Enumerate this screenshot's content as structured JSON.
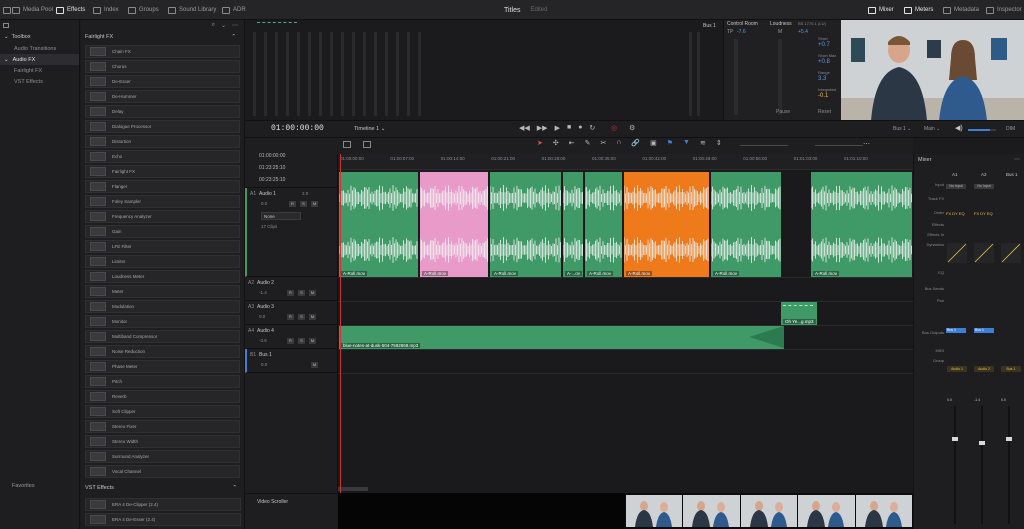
{
  "topbar": {
    "items": [
      {
        "label": "Media Pool",
        "icon": "media-pool-icon",
        "active": false
      },
      {
        "label": "Effects",
        "icon": "effects-icon",
        "active": true
      },
      {
        "label": "Index",
        "icon": "index-icon",
        "active": false
      },
      {
        "label": "Groups",
        "icon": "groups-icon",
        "active": false
      },
      {
        "label": "Sound Library",
        "icon": "sound-library-icon",
        "active": false
      },
      {
        "label": "ADR",
        "icon": "adr-icon",
        "active": false
      }
    ],
    "project_title": "Titles",
    "project_status": "Edited",
    "right_items": [
      {
        "label": "Mixer",
        "icon": "mixer-icon",
        "active": true
      },
      {
        "label": "Meters",
        "icon": "meters-icon",
        "active": true
      },
      {
        "label": "Metadata",
        "icon": "metadata-icon",
        "active": false
      },
      {
        "label": "Inspector",
        "icon": "inspector-icon",
        "active": false
      }
    ]
  },
  "toolbox": {
    "header": "Toolbox",
    "items": [
      {
        "label": "Audio Transitions",
        "selected": false
      },
      {
        "label": "Audio FX",
        "selected": true
      },
      {
        "label": "Fairlight FX",
        "selected": false
      },
      {
        "label": "VST Effects",
        "selected": false
      }
    ],
    "favorites_label": "Favorites"
  },
  "fx_panel": {
    "header": "Fairlight FX",
    "items": [
      "Chain FX",
      "Chorus",
      "De-Esser",
      "De-Hummer",
      "Delay",
      "Dialogue Processor",
      "Distortion",
      "Echo",
      "Fairlight FX",
      "Flanger",
      "Foley Sampler",
      "Frequency Analyzer",
      "Gain",
      "LFE Filter",
      "Limiter",
      "Loudness Meter",
      "Meter",
      "Modulation",
      "Monitor",
      "Multiband Compressor",
      "Noise Reduction",
      "Phase Meter",
      "Pitch",
      "Reverb",
      "Soft Clipper",
      "Stereo Fixer",
      "Stereo Width",
      "Surround Analyzer",
      "Vocal Channel"
    ],
    "vst_header": "VST Effects",
    "vst_items": [
      "ERA 4 De-Clipper (2.4)",
      "ERA 4 De-Esser (2.4)"
    ]
  },
  "meters": {
    "bus_label": "Bus 1",
    "control_room_label": "Control Room",
    "tp_label": "TP",
    "tp_value": "-7.6",
    "m_label": "M",
    "loudness_label": "Loudness",
    "loudness_standard": "BS.1770-1 (LU)",
    "loudness_value": "+5.4",
    "short_label": "Short",
    "short_value": "+0.7",
    "short_max_label": "Short Max",
    "short_max_value": "+0.8",
    "range_label": "Range",
    "range_value": "3.3",
    "integrated_label": "Integrated",
    "integrated_value": "-0.1",
    "pause_label": "Pause",
    "reset_label": "Reset"
  },
  "transport": {
    "timecode": "01:00:00:00",
    "timeline_name": "Timeline 1",
    "bus_select": "Bus 1",
    "main_select": "Main",
    "dim_label": "DIM",
    "monitor_level": 0.8
  },
  "timecodes": [
    "01:00:00:00",
    "01:23:25:10",
    "00:23:25:10"
  ],
  "ruler": [
    "01:00:00:00",
    "01:00:07:00",
    "01:00:14:00",
    "01:00:21:00",
    "01:00:28:00",
    "01:00:35:00",
    "01:00:42:00",
    "01:00:49:00",
    "01:00:56:00",
    "01:01:03:00",
    "01:01:10:00"
  ],
  "tracks": [
    {
      "id": "A1",
      "name": "Audio 1",
      "volume": "0.0",
      "channel": "2.0",
      "plugin": "None",
      "clips_count": "17 Clips"
    },
    {
      "id": "A2",
      "name": "Audio 2",
      "volume": "-1.4",
      "channel": "2.0"
    },
    {
      "id": "A3",
      "name": "Audio 3",
      "volume": "0.0",
      "channel": "2.0"
    },
    {
      "id": "A4",
      "name": "Audio 4",
      "volume": "-3.6",
      "channel": "2.0"
    },
    {
      "id": "B1",
      "name": "Bus 1",
      "volume": "0.0",
      "channel": "2.0"
    }
  ],
  "clips": {
    "a1": [
      "A-Roll.mov",
      "A-Roll.mov",
      "A-Roll.mov",
      "A-...ov",
      "A-Roll.mov",
      "A-Roll.mov",
      "A-Roll.mov",
      "A-Roll.mov"
    ],
    "a3": "Oh Ye...g.mp3",
    "a4": "blue-notes-at-dusk-504-7592868.mp3"
  },
  "colors": {
    "clip_green": "#3f9a67",
    "clip_pink": "#e89ac8",
    "clip_orange": "#ee7a1c",
    "accent_blue": "#3f7fd8",
    "playhead": "#d13030"
  },
  "mixer": {
    "title": "Mixer",
    "columns": [
      "A1",
      "A2",
      "Bus 1"
    ],
    "rows": [
      "Input",
      "Track FX",
      "Order",
      "Effects",
      "Effects In",
      "Dynamics",
      "EQ",
      "Bus Sends",
      "Pan",
      "Bus Outputs",
      "MIDI",
      "Group"
    ],
    "input_values": [
      "No Input",
      "No Input"
    ],
    "order_values": [
      "FX DY EQ",
      "FX DY EQ"
    ],
    "bus_output_values": [
      "Bus 1",
      "Bus 1"
    ],
    "channel_names": [
      "Audio 1",
      "Audio 2",
      "Bus 1"
    ],
    "fader_values": [
      "0.0",
      "-1.4",
      "0.0"
    ]
  },
  "video_scroller_label": "Video Scroller"
}
